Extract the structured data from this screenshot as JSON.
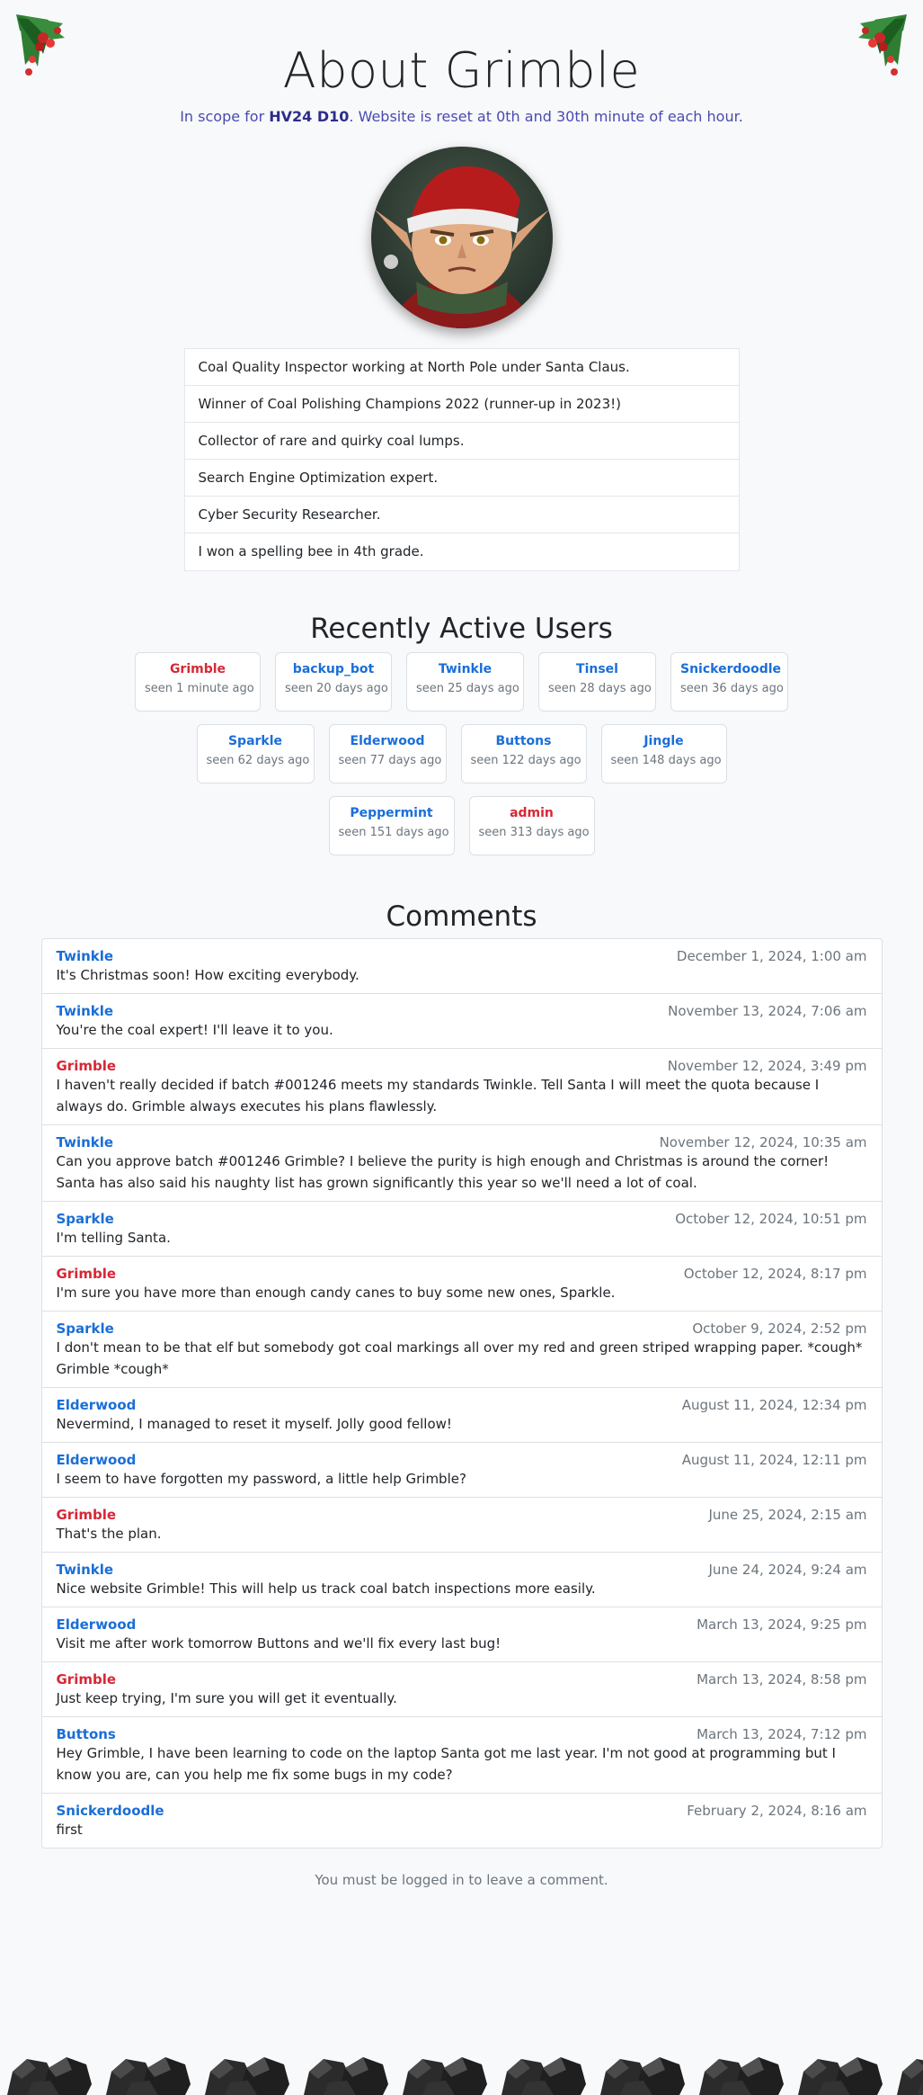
{
  "header": {
    "title": "About Grimble",
    "scope_prefix": "In scope for ",
    "scope_bold": "HV24 D10",
    "scope_suffix": ". Website is reset at 0th and 30th minute of each hour."
  },
  "profile": {
    "facts": [
      "Coal Quality Inspector working at North Pole under Santa Claus.",
      "Winner of Coal Polishing Champions 2022 (runner-up in 2023!)",
      "Collector of rare and quirky coal lumps.",
      "Search Engine Optimization expert.",
      "Cyber Security Researcher.",
      "I won a spelling bee in 4th grade."
    ]
  },
  "users_section": {
    "title": "Recently Active Users",
    "users": [
      {
        "name": "Grimble",
        "seen": "seen 1 minute ago",
        "highlight": true
      },
      {
        "name": "backup_bot",
        "seen": "seen 20 days ago",
        "highlight": false
      },
      {
        "name": "Twinkle",
        "seen": "seen 25 days ago",
        "highlight": false
      },
      {
        "name": "Tinsel",
        "seen": "seen 28 days ago",
        "highlight": false
      },
      {
        "name": "Snickerdoodle",
        "seen": "seen 36 days ago",
        "highlight": false
      },
      {
        "name": "Sparkle",
        "seen": "seen 62 days ago",
        "highlight": false
      },
      {
        "name": "Elderwood",
        "seen": "seen 77 days ago",
        "highlight": false
      },
      {
        "name": "Buttons",
        "seen": "seen 122 days ago",
        "highlight": false
      },
      {
        "name": "Jingle",
        "seen": "seen 148 days ago",
        "highlight": false
      },
      {
        "name": "Peppermint",
        "seen": "seen 151 days ago",
        "highlight": false
      },
      {
        "name": "admin",
        "seen": "seen 313 days ago",
        "highlight": true
      }
    ]
  },
  "comments_section": {
    "title": "Comments",
    "comments": [
      {
        "author": "Twinkle",
        "highlight": false,
        "date": "December 1, 2024, 1:00 am",
        "text": "It's Christmas soon! How exciting everybody."
      },
      {
        "author": "Twinkle",
        "highlight": false,
        "date": "November 13, 2024, 7:06 am",
        "text": "You're the coal expert! I'll leave it to you."
      },
      {
        "author": "Grimble",
        "highlight": true,
        "date": "November 12, 2024, 3:49 pm",
        "text": "I haven't really decided if batch #001246 meets my standards Twinkle. Tell Santa I will meet the quota because I always do. Grimble always executes his plans flawlessly."
      },
      {
        "author": "Twinkle",
        "highlight": false,
        "date": "November 12, 2024, 10:35 am",
        "text": "Can you approve batch #001246 Grimble? I believe the purity is high enough and Christmas is around the corner! Santa has also said his naughty list has grown significantly this year so we'll need a lot of coal."
      },
      {
        "author": "Sparkle",
        "highlight": false,
        "date": "October 12, 2024, 10:51 pm",
        "text": "I'm telling Santa."
      },
      {
        "author": "Grimble",
        "highlight": true,
        "date": "October 12, 2024, 8:17 pm",
        "text": "I'm sure you have more than enough candy canes to buy some new ones, Sparkle."
      },
      {
        "author": "Sparkle",
        "highlight": false,
        "date": "October 9, 2024, 2:52 pm",
        "text": "I don't mean to be that elf but somebody got coal markings all over my red and green striped wrapping paper. *cough* Grimble *cough*"
      },
      {
        "author": "Elderwood",
        "highlight": false,
        "date": "August 11, 2024, 12:34 pm",
        "text": "Nevermind, I managed to reset it myself. Jolly good fellow!"
      },
      {
        "author": "Elderwood",
        "highlight": false,
        "date": "August 11, 2024, 12:11 pm",
        "text": "I seem to have forgotten my password, a little help Grimble?"
      },
      {
        "author": "Grimble",
        "highlight": true,
        "date": "June 25, 2024, 2:15 am",
        "text": "That's the plan."
      },
      {
        "author": "Twinkle",
        "highlight": false,
        "date": "June 24, 2024, 9:24 am",
        "text": "Nice website Grimble! This will help us track coal batch inspections more easily."
      },
      {
        "author": "Elderwood",
        "highlight": false,
        "date": "March 13, 2024, 9:25 pm",
        "text": "Visit me after work tomorrow Buttons and we'll fix every last bug!"
      },
      {
        "author": "Grimble",
        "highlight": true,
        "date": "March 13, 2024, 8:58 pm",
        "text": "Just keep trying, I'm sure you will get it eventually."
      },
      {
        "author": "Buttons",
        "highlight": false,
        "date": "March 13, 2024, 7:12 pm",
        "text": "Hey Grimble, I have been learning to code on the laptop Santa got me last year. I'm not good at programming but I know you are, can you help me fix some bugs in my code?"
      },
      {
        "author": "Snickerdoodle",
        "highlight": false,
        "date": "February 2, 2024, 8:16 am",
        "text": "first"
      }
    ],
    "login_note": "You must be logged in to leave a comment."
  },
  "colors": {
    "accent_blue": "#1a6ed8",
    "accent_red": "#d62836",
    "scope_text": "#4a4ab0",
    "background": "#f8f9fb"
  },
  "icons": {
    "corner_left": "holly-berries-icon",
    "corner_right": "holly-berries-icon",
    "footer": "coal-lump-icon"
  }
}
